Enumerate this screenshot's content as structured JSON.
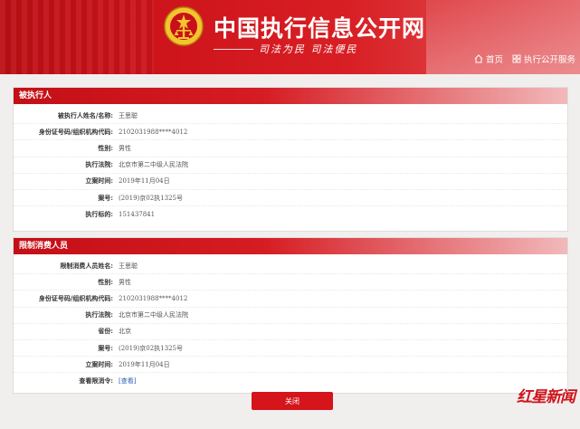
{
  "header": {
    "title": "中国执行信息公开网",
    "slogan": "司法为民  司法便民",
    "nav": [
      {
        "label": "首页",
        "icon": "home-icon"
      },
      {
        "label": "执行公开服务",
        "icon": "grid-icon"
      }
    ]
  },
  "executed_person": {
    "section_title": "被执行人",
    "rows": [
      {
        "label": "被执行人姓名/名称:",
        "value": "王思聪"
      },
      {
        "label": "身份证号码/组织机构代码:",
        "value": "2102031988****4012"
      },
      {
        "label": "性别:",
        "value": "男性"
      },
      {
        "label": "执行法院:",
        "value": "北京市第二中级人民法院"
      },
      {
        "label": "立案时间:",
        "value": "2019年11月04日"
      },
      {
        "label": "案号:",
        "value": "(2019)京02执1325号"
      },
      {
        "label": "执行标的:",
        "value": "151437841"
      }
    ]
  },
  "restricted_consumer": {
    "section_title": "限制消费人员",
    "rows": [
      {
        "label": "限制消费人员姓名:",
        "value": "王思聪"
      },
      {
        "label": "性别:",
        "value": "男性"
      },
      {
        "label": "身份证号码/组织机构代码:",
        "value": "2102031988****4012"
      },
      {
        "label": "执行法院:",
        "value": "北京市第二中级人民法院"
      },
      {
        "label": "省份:",
        "value": "北京"
      },
      {
        "label": "案号:",
        "value": "(2019)京02执1325号"
      },
      {
        "label": "立案时间:",
        "value": "2019年11月04日"
      },
      {
        "label": "查看限消令:",
        "value": "[查看]"
      }
    ]
  },
  "actions": {
    "close_label": "关闭"
  },
  "watermark": {
    "text": "红星新闻"
  },
  "colors": {
    "brand_red": "#d5141b",
    "link_blue": "#2a5db0"
  }
}
